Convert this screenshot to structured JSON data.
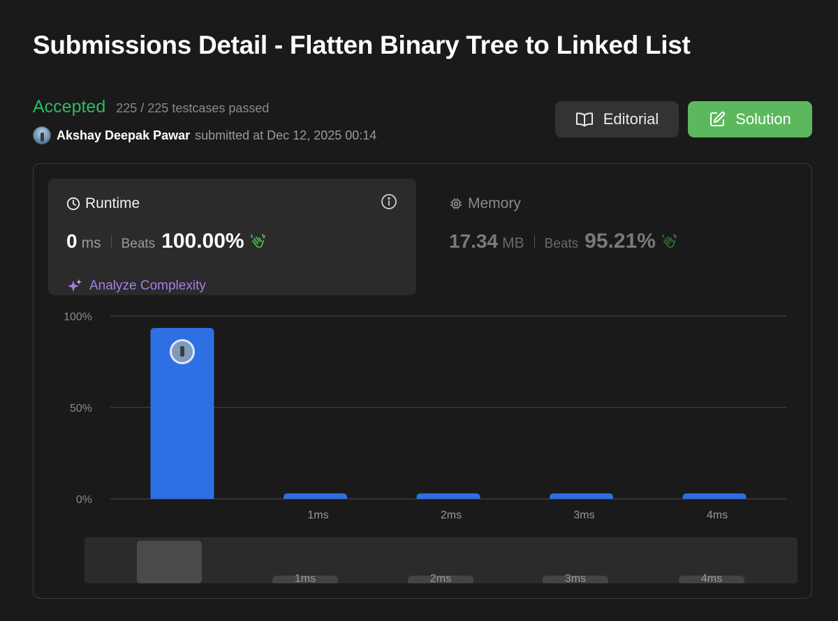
{
  "page": {
    "title": "Submissions Detail - Flatten Binary Tree to Linked List"
  },
  "submission": {
    "status": "Accepted",
    "testcases": "225 / 225 testcases passed",
    "submitter": "Akshay Deepak Pawar",
    "submitted_text": "submitted at Dec 12, 2025 00:14"
  },
  "actions": {
    "editorial_label": "Editorial",
    "solution_label": "Solution"
  },
  "runtime": {
    "label": "Runtime",
    "value": "0",
    "unit": "ms",
    "beats_label": "Beats",
    "beats_value": "100.00%",
    "analyze_label": "Analyze Complexity"
  },
  "memory": {
    "label": "Memory",
    "value": "17.34",
    "unit": "MB",
    "beats_label": "Beats",
    "beats_value": "95.21%"
  },
  "colors": {
    "accepted": "#2cbb5d",
    "bar": "#2f6fe4",
    "solution_button": "#5cb85c",
    "analyze": "#a77de8",
    "clap": "#4caf50"
  },
  "icons": {
    "editorial": "book-icon",
    "solution": "edit-icon",
    "runtime": "clock-icon",
    "memory": "chip-icon",
    "info": "info-icon",
    "analyze": "sparkle-icon",
    "beats": "clap-icon"
  },
  "chart_data": {
    "type": "bar",
    "categories": [
      "",
      "1ms",
      "2ms",
      "3ms",
      "4ms"
    ],
    "values": [
      93.5,
      3,
      3,
      3,
      3
    ],
    "yticks": [
      "100%",
      "50%",
      "0%"
    ],
    "ylim": [
      0,
      100
    ],
    "highlight_index": 0,
    "grid": true
  },
  "range_selector": {
    "labels": [
      "1ms",
      "2ms",
      "3ms",
      "4ms"
    ]
  }
}
